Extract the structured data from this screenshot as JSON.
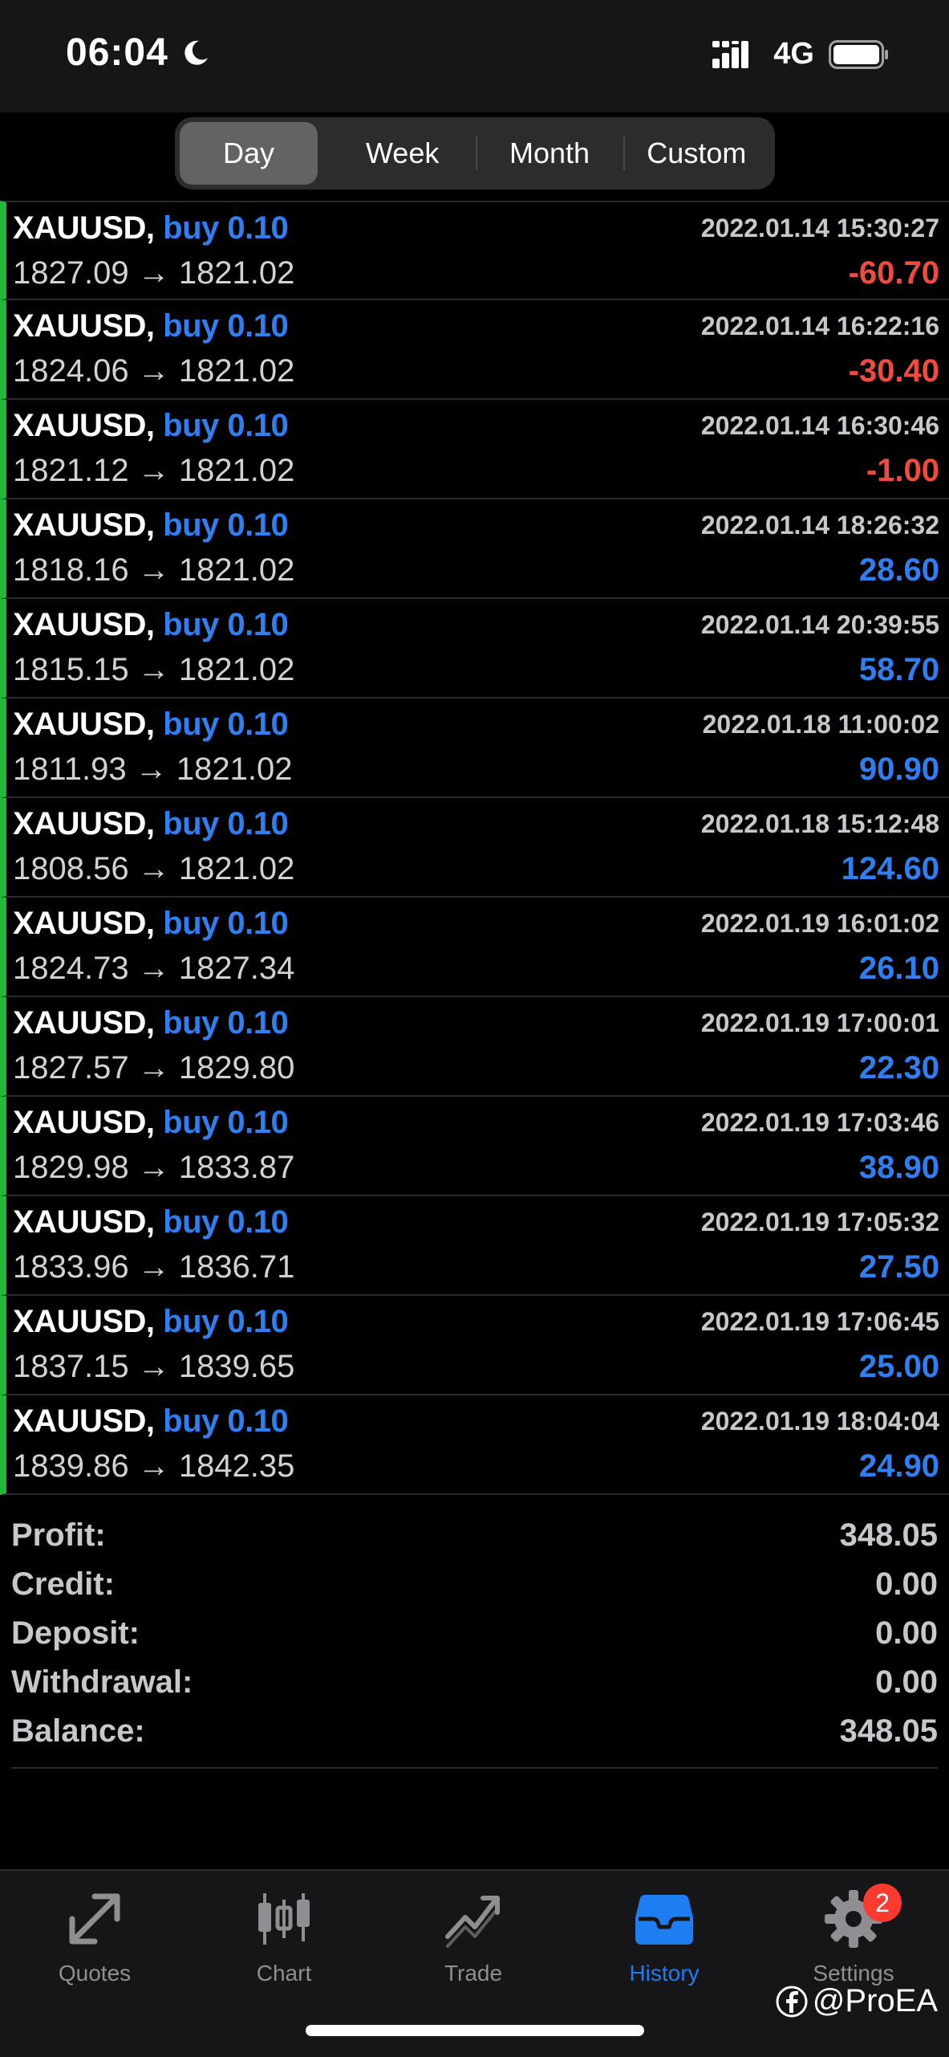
{
  "status_bar": {
    "time": "06:04",
    "network": "4G"
  },
  "period_tabs": [
    {
      "label": "Day",
      "active": true
    },
    {
      "label": "Week",
      "active": false
    },
    {
      "label": "Month",
      "active": false
    },
    {
      "label": "Custom",
      "active": false
    }
  ],
  "deals": [
    {
      "symbol": "XAUUSD,",
      "type": "buy 0.10",
      "time": "2022.01.14 15:30:27",
      "prices": "1827.09 → 1821.02",
      "profit": "-60.70"
    },
    {
      "symbol": "XAUUSD,",
      "type": "buy 0.10",
      "time": "2022.01.14 16:22:16",
      "prices": "1824.06 → 1821.02",
      "profit": "-30.40"
    },
    {
      "symbol": "XAUUSD,",
      "type": "buy 0.10",
      "time": "2022.01.14 16:30:46",
      "prices": "1821.12 → 1821.02",
      "profit": "-1.00"
    },
    {
      "symbol": "XAUUSD,",
      "type": "buy 0.10",
      "time": "2022.01.14 18:26:32",
      "prices": "1818.16 → 1821.02",
      "profit": "28.60"
    },
    {
      "symbol": "XAUUSD,",
      "type": "buy 0.10",
      "time": "2022.01.14 20:39:55",
      "prices": "1815.15 → 1821.02",
      "profit": "58.70"
    },
    {
      "symbol": "XAUUSD,",
      "type": "buy 0.10",
      "time": "2022.01.18 11:00:02",
      "prices": "1811.93 → 1821.02",
      "profit": "90.90"
    },
    {
      "symbol": "XAUUSD,",
      "type": "buy 0.10",
      "time": "2022.01.18 15:12:48",
      "prices": "1808.56 → 1821.02",
      "profit": "124.60"
    },
    {
      "symbol": "XAUUSD,",
      "type": "buy 0.10",
      "time": "2022.01.19 16:01:02",
      "prices": "1824.73 → 1827.34",
      "profit": "26.10"
    },
    {
      "symbol": "XAUUSD,",
      "type": "buy 0.10",
      "time": "2022.01.19 17:00:01",
      "prices": "1827.57 → 1829.80",
      "profit": "22.30"
    },
    {
      "symbol": "XAUUSD,",
      "type": "buy 0.10",
      "time": "2022.01.19 17:03:46",
      "prices": "1829.98 → 1833.87",
      "profit": "38.90"
    },
    {
      "symbol": "XAUUSD,",
      "type": "buy 0.10",
      "time": "2022.01.19 17:05:32",
      "prices": "1833.96 → 1836.71",
      "profit": "27.50"
    },
    {
      "symbol": "XAUUSD,",
      "type": "buy 0.10",
      "time": "2022.01.19 17:06:45",
      "prices": "1837.15 → 1839.65",
      "profit": "25.00"
    },
    {
      "symbol": "XAUUSD,",
      "type": "buy 0.10",
      "time": "2022.01.19 18:04:04",
      "prices": "1839.86 → 1842.35",
      "profit": "24.90"
    }
  ],
  "summary": [
    {
      "label": "Profit:",
      "value": "348.05"
    },
    {
      "label": "Credit:",
      "value": "0.00"
    },
    {
      "label": "Deposit:",
      "value": "0.00"
    },
    {
      "label": "Withdrawal:",
      "value": "0.00"
    },
    {
      "label": "Balance:",
      "value": "348.05"
    }
  ],
  "tabbar": {
    "quotes": "Quotes",
    "chart": "Chart",
    "trade": "Trade",
    "history": "History",
    "settings": "Settings",
    "settings_badge": "2",
    "active": "history"
  },
  "watermark": "@ProEA",
  "colors": {
    "buy_blue": "#2f7ff0",
    "loss_red": "#f14b3e",
    "row_marker_green": "#22b83a",
    "tab_active": "#1f7df2"
  }
}
